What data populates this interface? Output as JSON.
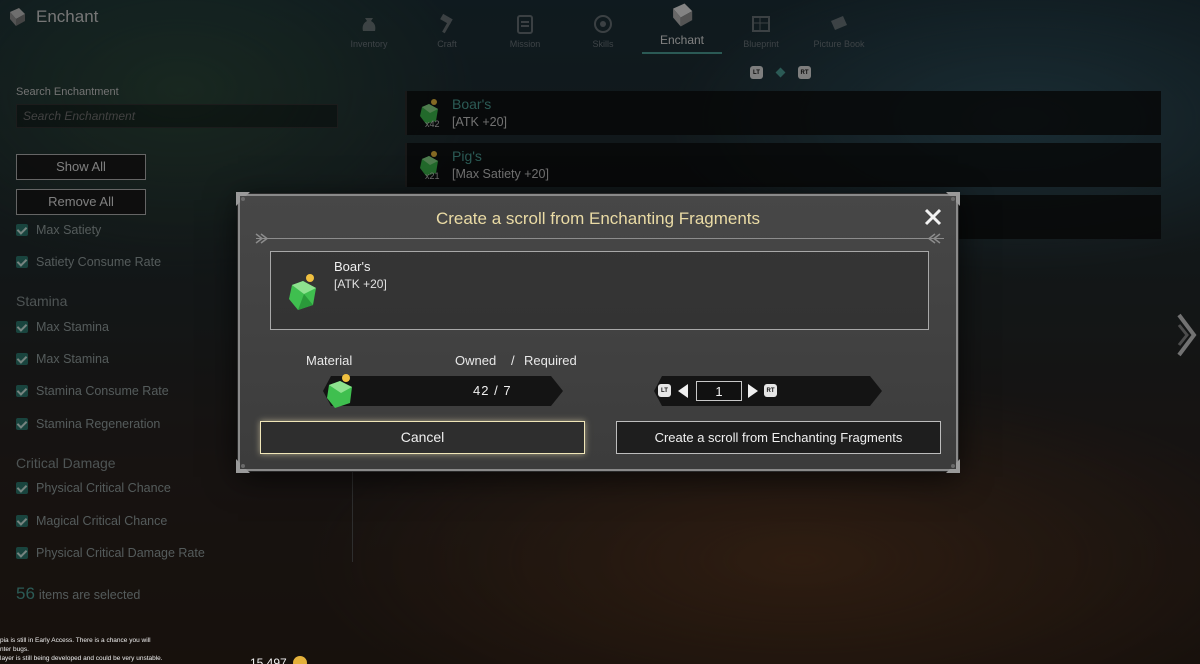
{
  "app": {
    "title": "Enchant",
    "icon": "enchant-icon"
  },
  "nav": {
    "tabs": [
      {
        "label": "Inventory",
        "icon": "pouch-icon"
      },
      {
        "label": "Craft",
        "icon": "hammer-icon"
      },
      {
        "label": "Mission",
        "icon": "clipboard-icon"
      },
      {
        "label": "Skills",
        "icon": "swirl-icon"
      },
      {
        "label": "Enchant",
        "icon": "enchant-icon",
        "active": true
      },
      {
        "label": "Blueprint",
        "icon": "blueprint-icon"
      },
      {
        "label": "Picture Book",
        "icon": "book-icon"
      }
    ],
    "prev_button": "LT",
    "next_button": "RT"
  },
  "filters": {
    "search_label": "Search Enchantment",
    "search_placeholder": "Search Enchantment",
    "show_all": "Show All",
    "remove_all": "Remove All",
    "satiety_items": [
      "Max Satiety",
      "Satiety Consume Rate"
    ],
    "stamina_header": "Stamina",
    "stamina_items": [
      "Max Stamina",
      "Max Stamina",
      "Stamina Consume Rate",
      "Stamina Regeneration"
    ],
    "critical_header": "Critical Damage",
    "critical_items": [
      "Physical Critical Chance",
      "Magical Critical Chance",
      "Physical Critical Damage Rate"
    ],
    "selected_count": "56",
    "selected_text": "items are selected"
  },
  "list": [
    {
      "name": "Boar's",
      "effect": "[ATK +20]",
      "qty": "x42"
    },
    {
      "name": "Pig's",
      "effect": "[Max Satiety +20]",
      "qty": "x21"
    }
  ],
  "notice": {
    "line1": "pia is still in Early Access. There is a chance you will",
    "line2": "nter bugs.",
    "line3": "layer is still being developed and could be very unstable.",
    "money": "15,497"
  },
  "dialog": {
    "title": "Create a scroll from Enchanting Fragments",
    "item": {
      "name": "Boar's",
      "effect": "[ATK +20]"
    },
    "material_label": "Material",
    "owned_label": "Owned",
    "slash": "/",
    "required_label": "Required",
    "owned": "42",
    "required": "7",
    "stepper_left_glyph": "LT",
    "stepper_right_glyph": "RT",
    "quantity": "1",
    "cancel_label": "Cancel",
    "confirm_label": "Create a scroll from Enchanting Fragments"
  },
  "colors": {
    "accent": "#4fa59b",
    "title_gold": "#eadba5",
    "fragment_green": "#3fbf4f"
  }
}
